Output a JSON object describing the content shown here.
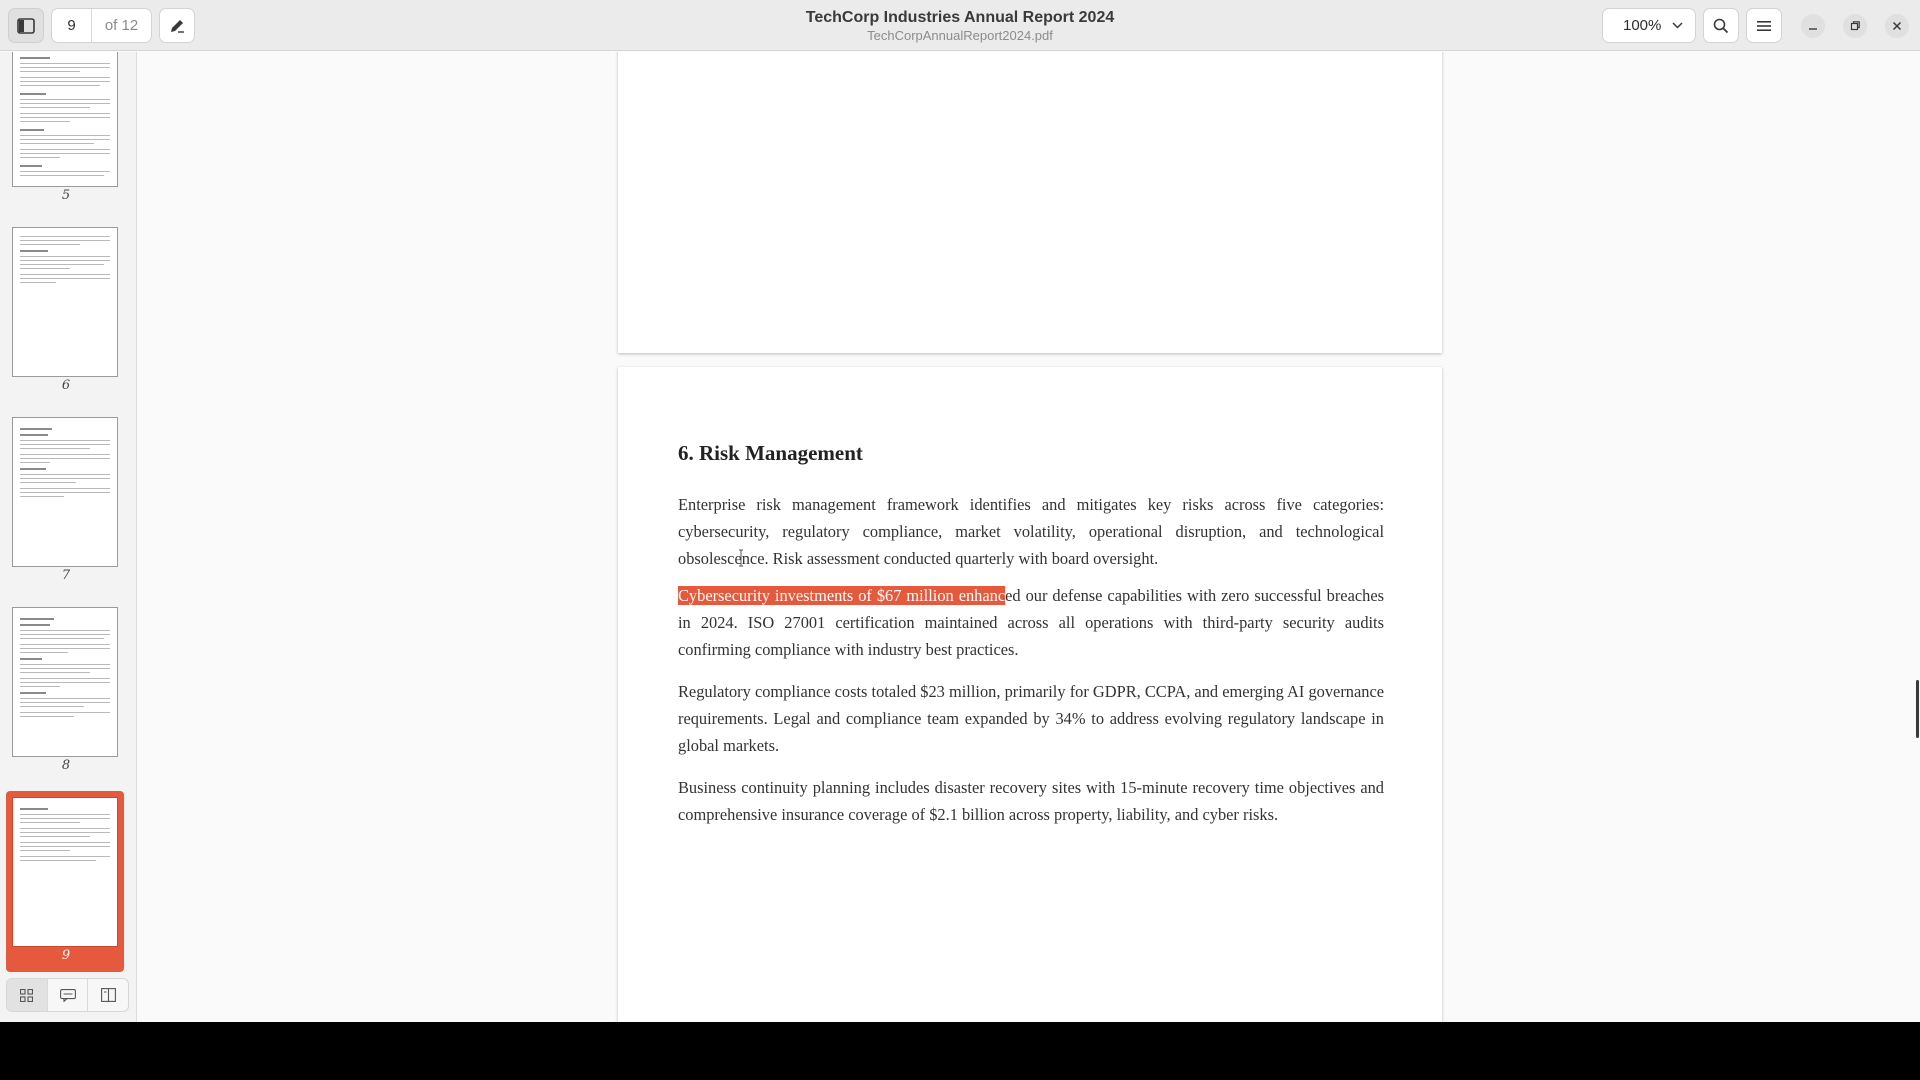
{
  "header": {
    "current_page": "9",
    "total_pages_label": "of 12",
    "title": "TechCorp Industries Annual Report 2024",
    "filename": "TechCorpAnnualReport2024.pdf",
    "zoom": "100%"
  },
  "sidebar": {
    "thumbnails": [
      {
        "label": "5"
      },
      {
        "label": "6"
      },
      {
        "label": "7"
      },
      {
        "label": "8"
      },
      {
        "label": "9",
        "selected": true
      }
    ]
  },
  "document": {
    "heading": "6. Risk Management",
    "p1": "Enterprise risk management framework identifies and mitigates key risks across five categories: cybersecurity, regulatory compliance, market volatility, operational disruption, and technological obsolescence. Risk assessment conducted quarterly with board oversight.",
    "p2_selected": "Cybersecurity investments of $67 million enhanc",
    "p2_rest": "ed our defense capabilities with zero successful breaches in 2024. ISO 27001 certification maintained across all operations with third-party security audits confirming compliance with industry best practices.",
    "p3": "Regulatory compliance costs totaled $23 million, primarily for GDPR, CCPA, and emerging AI governance requirements. Legal and compliance team expanded by 34% to address evolving regulatory landscape in global markets.",
    "p4": "Business continuity planning includes disaster recovery sites with 15-minute recovery time objectives and comprehensive insurance coverage of $2.1 billion across property, liability, and cyber risks."
  },
  "colors": {
    "accent": "#e55a3c",
    "header_bg": "#ebebeb",
    "sidebar_bg": "#f3f3f3"
  }
}
